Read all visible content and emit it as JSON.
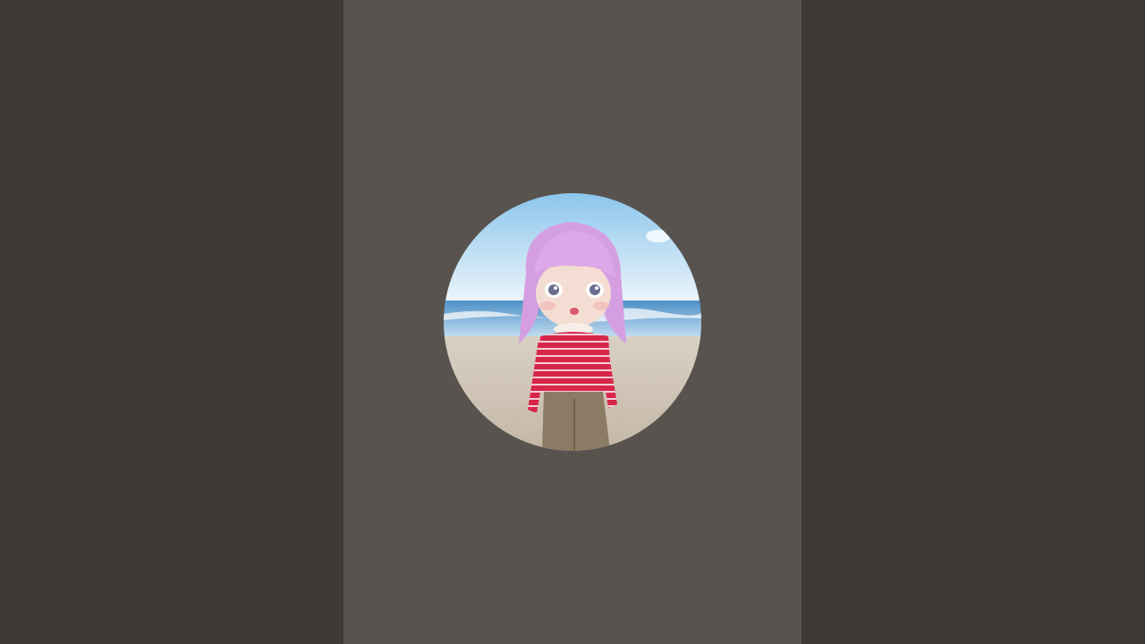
{
  "colors": {
    "side_background": "#3e3936",
    "center_background": "#58534e",
    "sky_top": "#9fd0ef",
    "sky_bottom": "#eaf4fb",
    "sea": "#5f9ed1",
    "sand": "#cfc4b6",
    "hair": "#d8a3e3",
    "sweater_red": "#d8264a",
    "sweater_stripe": "#f6d4da",
    "pants": "#8a7a63",
    "skin": "#f3d9cf"
  },
  "avatar": {
    "description_icon": "channel-avatar-icon"
  }
}
